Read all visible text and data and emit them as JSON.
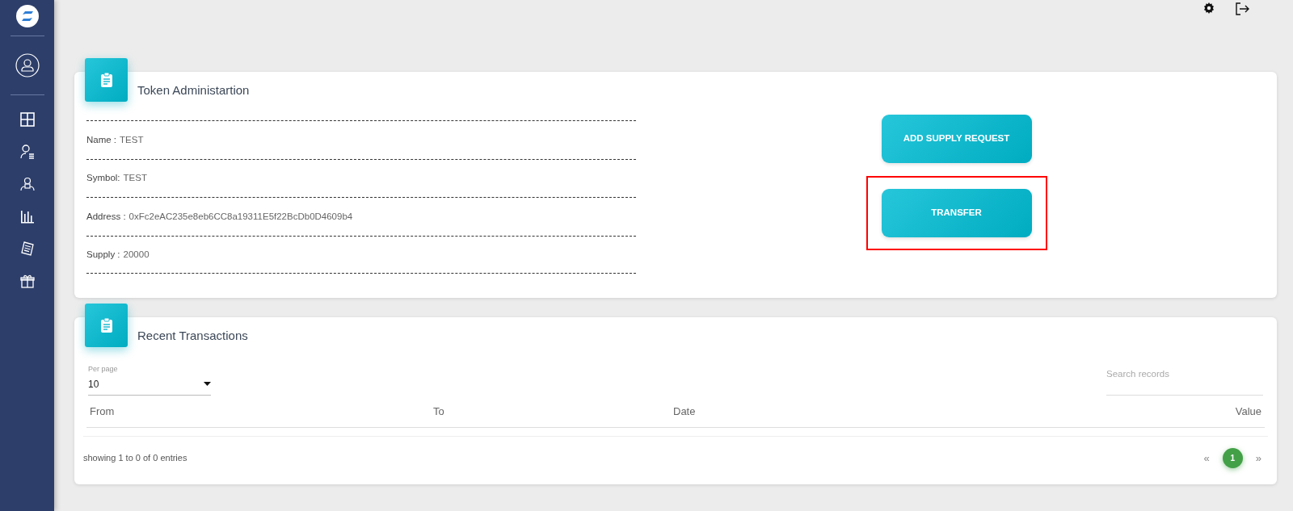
{
  "token_card": {
    "title": "Token Administartion",
    "fields": [
      {
        "label": "Name :",
        "value": "TEST"
      },
      {
        "label": "Symbol:",
        "value": "TEST"
      },
      {
        "label": "Address :",
        "value": "0xFc2eAC235e8eb6CC8a19311E5f22BcDb0D4609b4"
      },
      {
        "label": "Supply :",
        "value": "20000"
      }
    ],
    "buttons": [
      {
        "label": "ADD SUPPLY REQUEST",
        "highlighted": false
      },
      {
        "label": "TRANSFER",
        "highlighted": true
      }
    ]
  },
  "transactions_card": {
    "title": "Recent Transactions",
    "per_page": {
      "label": "Per page",
      "value": "10"
    },
    "search": {
      "placeholder": "Search records"
    },
    "table": {
      "columns": [
        "From",
        "To",
        "Date",
        "Value"
      ]
    },
    "footer": "showing 1 to 0 of 0 entries",
    "pagination": {
      "prev": "«",
      "pages": [
        {
          "label": "1",
          "selected": true
        }
      ],
      "next": "»"
    }
  }
}
